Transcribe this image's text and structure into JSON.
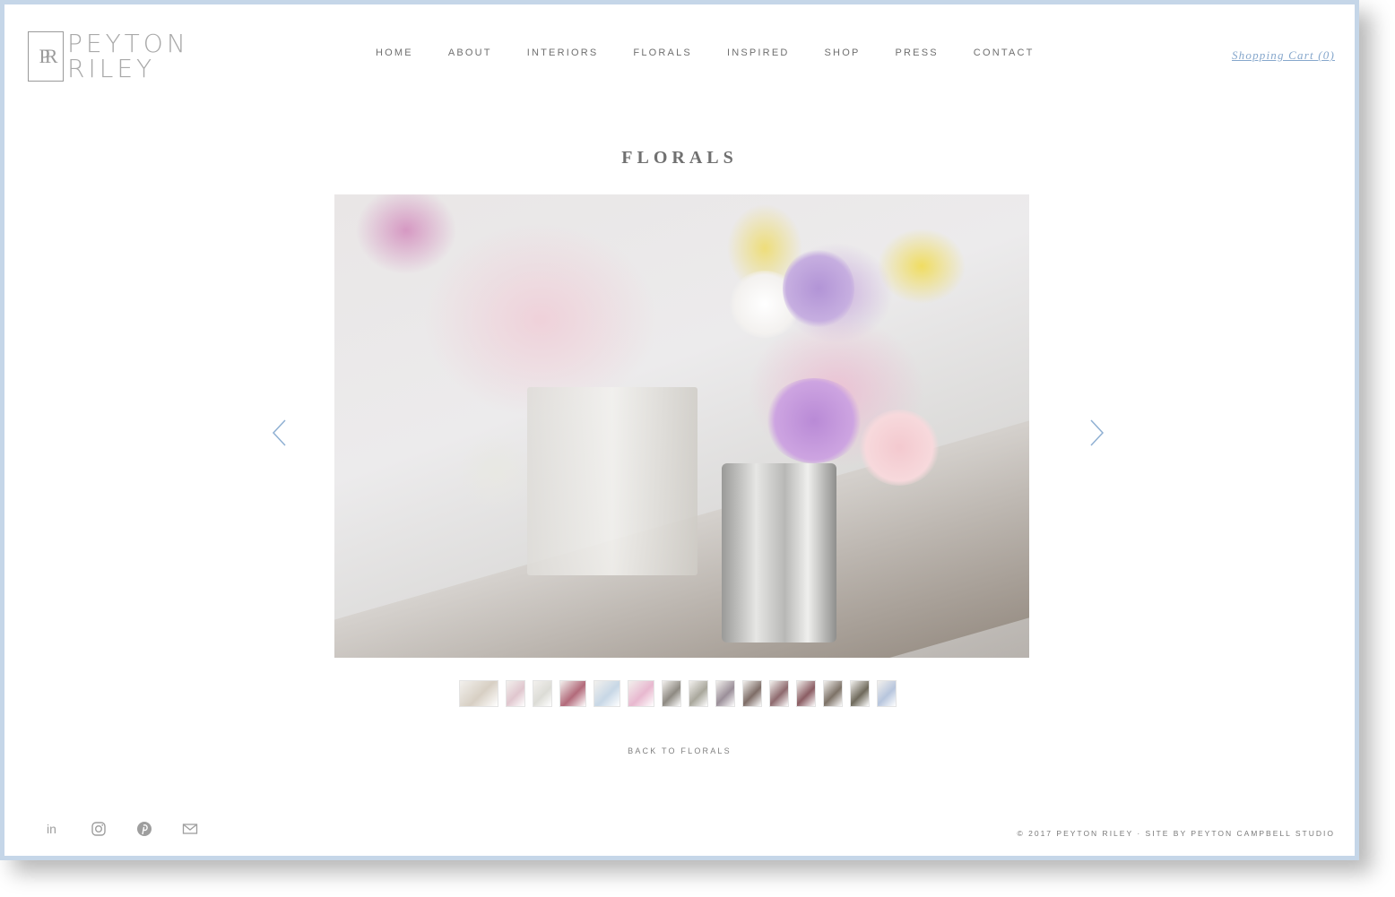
{
  "logo": {
    "mark": "PR",
    "line1": "PEYTON",
    "line2": "RILEY"
  },
  "nav": {
    "items": [
      "HOME",
      "ABOUT",
      "INTERIORS",
      "FLORALS",
      "INSPIRED",
      "SHOP",
      "PRESS",
      "CONTACT"
    ]
  },
  "cart": {
    "label": "Shopping Cart (0)"
  },
  "page": {
    "title": "FLORALS"
  },
  "gallery": {
    "thumbnails": [
      {
        "color": "#d7cfc3"
      },
      {
        "color": "#e0c6ce"
      },
      {
        "color": "#dcdcd6"
      },
      {
        "color": "#b26a7a"
      },
      {
        "color": "#c7d7e6"
      },
      {
        "color": "#e8b8cf"
      },
      {
        "color": "#8e8a82"
      },
      {
        "color": "#a9a79c"
      },
      {
        "color": "#9b8f99"
      },
      {
        "color": "#7e6d67"
      },
      {
        "color": "#8e6a6e"
      },
      {
        "color": "#8b5d63"
      },
      {
        "color": "#7d7267"
      },
      {
        "color": "#6f6a5c"
      },
      {
        "color": "#b7c5dd"
      }
    ]
  },
  "back_link": {
    "label": "BACK TO FLORALS"
  },
  "footer": {
    "copyright": "© 2017 PEYTON RILEY · SITE BY PEYTON CAMPBELL STUDIO"
  },
  "colors": {
    "accent": "#86a7cc",
    "frame": "#c5d6e8",
    "text": "#707070"
  },
  "icons": [
    "linkedin-icon",
    "instagram-icon",
    "pinterest-icon",
    "mail-icon",
    "chevron-left-icon",
    "chevron-right-icon"
  ]
}
